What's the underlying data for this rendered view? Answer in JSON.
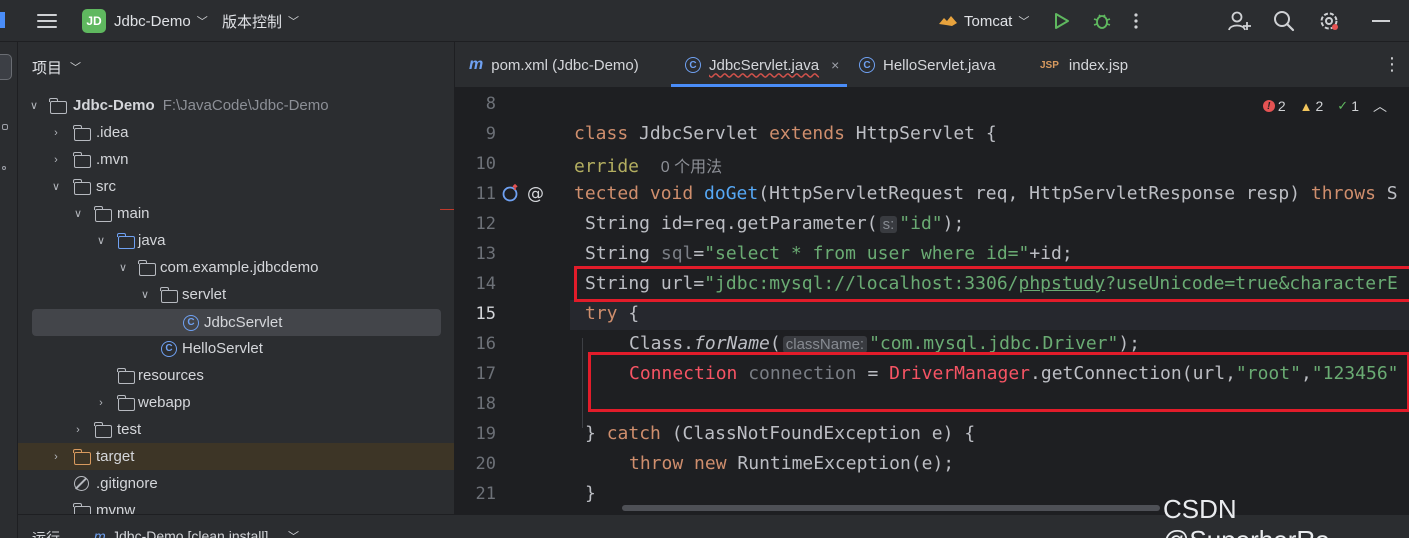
{
  "titlebar": {
    "project_badge": "JD",
    "project_name": "Jdbc-Demo",
    "vcs_label": "版本控制",
    "run_config": "Tomcat"
  },
  "project_panel": {
    "title": "项目",
    "tree": [
      {
        "label": "Jdbc-Demo",
        "hint": "F:\\JavaCode\\Jdbc-Demo"
      },
      {
        "label": ".idea"
      },
      {
        "label": ".mvn"
      },
      {
        "label": "src"
      },
      {
        "label": "main"
      },
      {
        "label": "java"
      },
      {
        "label": "com.example.jdbcdemo"
      },
      {
        "label": "servlet"
      },
      {
        "label": "JdbcServlet"
      },
      {
        "label": "HelloServlet"
      },
      {
        "label": "resources"
      },
      {
        "label": "webapp"
      },
      {
        "label": "test"
      },
      {
        "label": "target"
      },
      {
        "label": ".gitignore"
      },
      {
        "label": "mvnw"
      }
    ]
  },
  "bottom_bar": {
    "run_label": "运行",
    "run_target": "Jdbc-Demo [clean,install]"
  },
  "editor": {
    "tabs": [
      {
        "label": "pom.xml (Jdbc-Demo)"
      },
      {
        "label": "JdbcServlet.java"
      },
      {
        "label": "HelloServlet.java"
      },
      {
        "label": "index.jsp"
      }
    ],
    "inspections": {
      "errors": "2",
      "warnings": "2",
      "ok": "1"
    },
    "line_numbers": [
      "8",
      "9",
      "10",
      "11",
      "12",
      "13",
      "14",
      "15",
      "16",
      "17",
      "18",
      "19",
      "20",
      "21"
    ],
    "current_line": "15",
    "code": {
      "l9_a": "class ",
      "l9_b": "JdbcServlet ",
      "l9_c": "extends ",
      "l9_d": "HttpServlet {",
      "l10_a": "erride",
      "l10_b": "0 个用法",
      "l11_a": "tected ",
      "l11_b": "void ",
      "l11_c": "doGet",
      "l11_d": "(HttpServletRequest req, HttpServletResponse resp) ",
      "l11_e": "throws ",
      "l11_f": "S",
      "l12_a": "String id=req.getParameter(",
      "l12_hint": "s:",
      "l12_str": "\"id\"",
      "l12_b": ");",
      "l13_a": "String ",
      "l13_b": "sql",
      "l13_c": "=",
      "l13_str": "\"select * from user where id=\"",
      "l13_d": "+id;",
      "l14_a": "String url=",
      "l14_str1": "\"jdbc:mysql://localhost:3306/",
      "l14_str2": "phpstudy",
      "l14_str3": "?useUnicode=true&characterE",
      "l15_a": "try ",
      "l15_b": "{",
      "l16_a": "Class.",
      "l16_b": "forName",
      "l16_c": "(",
      "l16_hint": "className:",
      "l16_str": "\"com.mysql.jdbc.Driver\"",
      "l16_d": ");",
      "l17_a": "Connection ",
      "l17_b": "connection ",
      "l17_c": "= ",
      "l17_d": "DriverManager",
      "l17_e": ".getConnection(url,",
      "l17_str1": "\"root\"",
      "l17_f": ",",
      "l17_str2": "\"123456\"",
      "l19_a": "} ",
      "l19_b": "catch ",
      "l19_c": "(ClassNotFoundException e) {",
      "l20_a": "throw ",
      "l20_b": "new ",
      "l20_c": "RuntimeException(e);",
      "l21_a": "}"
    }
  },
  "watermark": "CSDN @SuperherRo",
  "colors": {
    "keyword": "#cf8e6d",
    "string": "#6aab73",
    "method": "#56a8f5",
    "error": "#f75464",
    "annotation_box": "#e21c2a"
  }
}
